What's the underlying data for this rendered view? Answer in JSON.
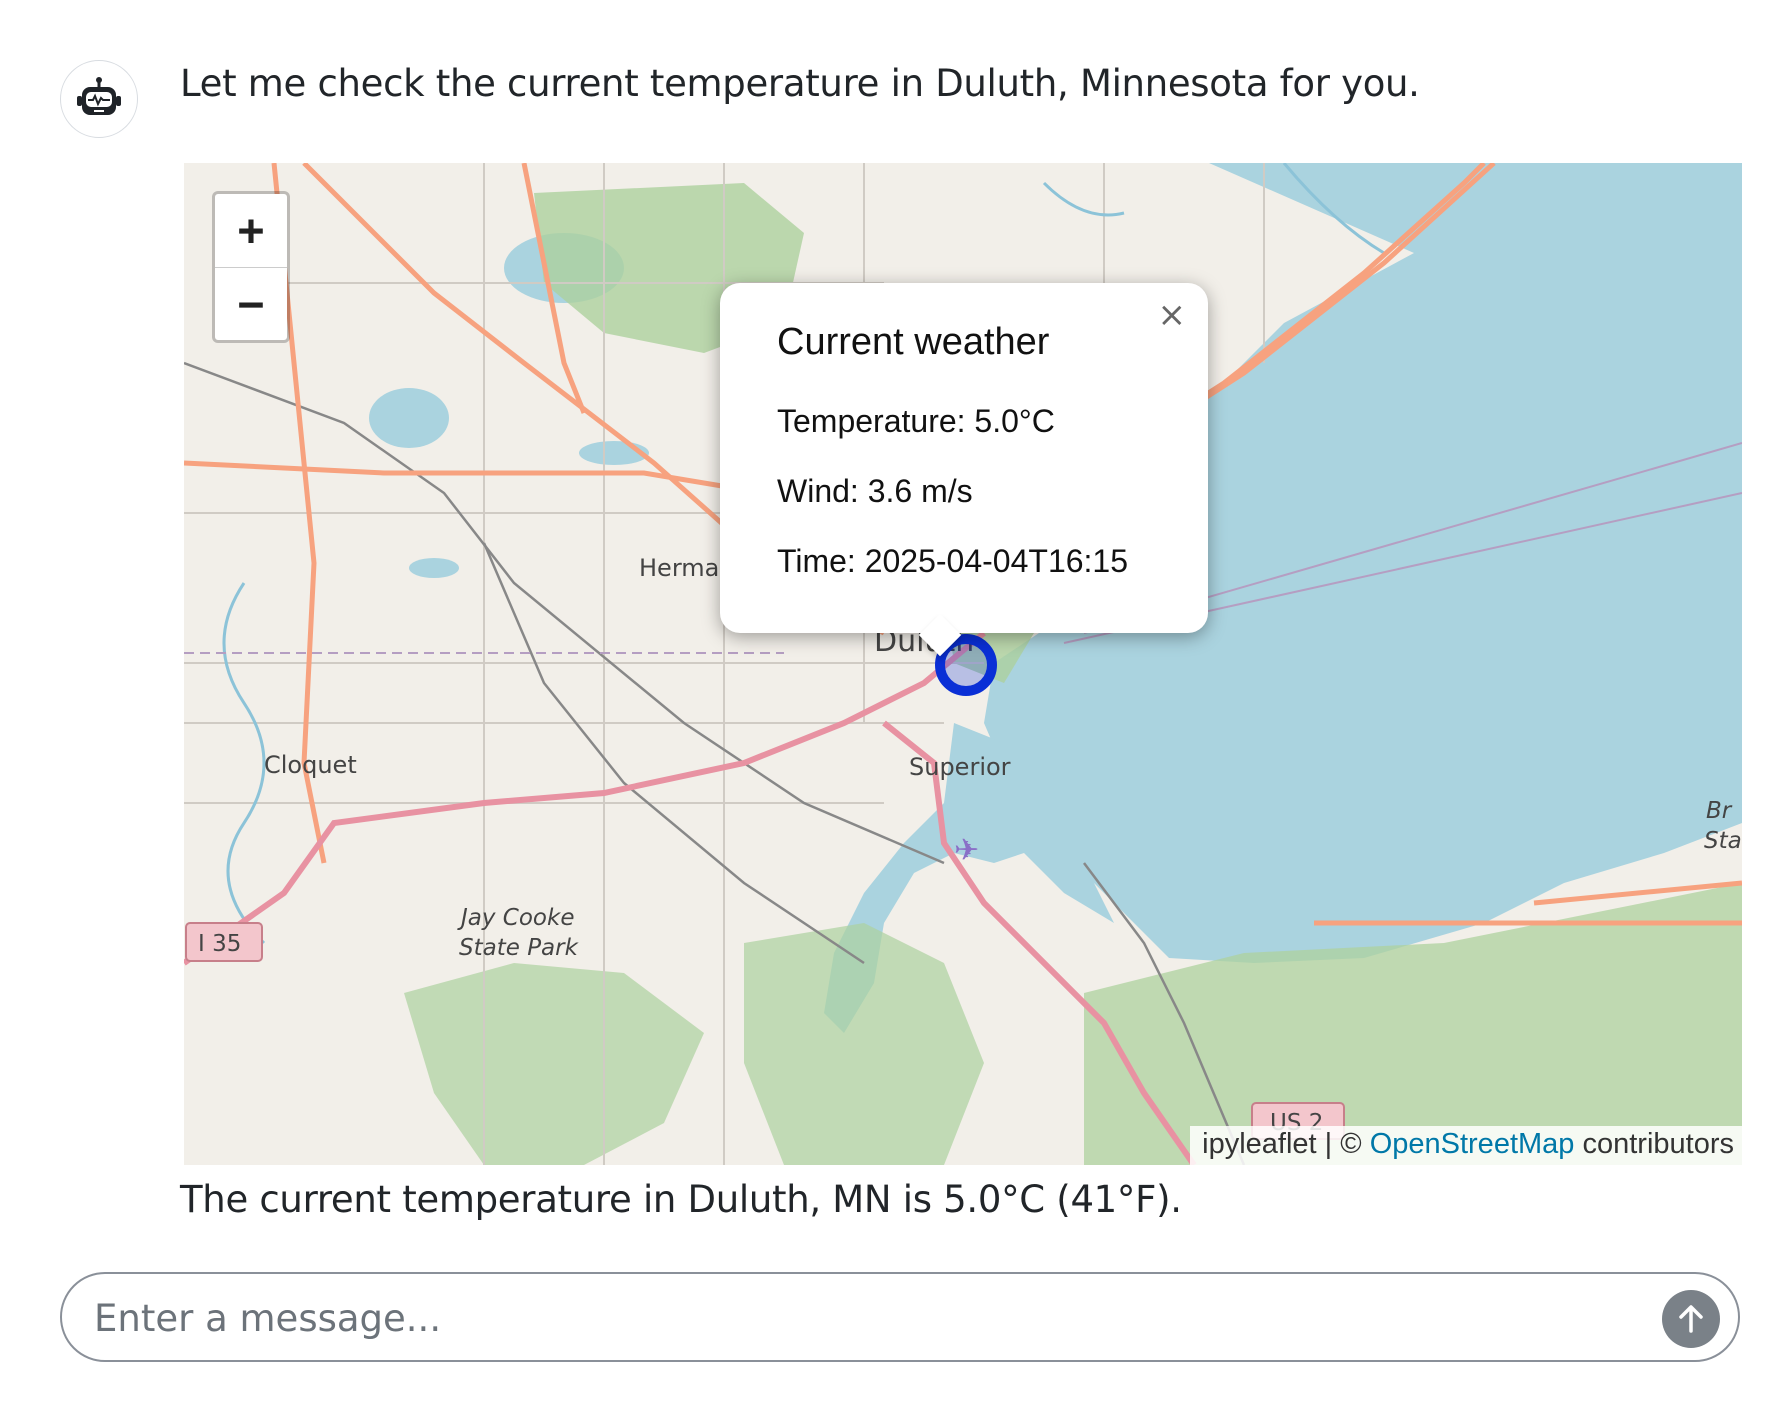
{
  "assistant": {
    "intro_message": "Let me check the current temperature in Duluth, Minnesota for you.",
    "result_message": "The current temperature in Duluth, MN is 5.0°C (41°F)."
  },
  "map": {
    "zoom_in_label": "+",
    "zoom_out_label": "−",
    "place_labels": {
      "duluth": "Duluth",
      "superior": "Superior",
      "cloquet": "Cloquet",
      "hermantown": "Herma",
      "jay_cooke_1": "Jay Cooke",
      "jay_cooke_2": "State Park",
      "brule_1": "Br",
      "brule_2": "Sta",
      "highway_i35": "I 35",
      "highway_us2": "US 2"
    },
    "popup": {
      "close_label": "×",
      "title": "Current weather",
      "temperature": "Temperature: 5.0°C",
      "wind": "Wind: 3.6 m/s",
      "time": "Time: 2025-04-04T16:15"
    },
    "attribution": {
      "prefix": "ipyleaflet | © ",
      "link": "OpenStreetMap",
      "suffix": " contributors"
    },
    "colors": {
      "land": "#f2efe9",
      "water": "#aad3df",
      "forest": "#add19e",
      "motorway": "#e892a2",
      "primary_road": "#f7a27f",
      "marker": "#0a2fd6"
    }
  },
  "composer": {
    "placeholder": "Enter a message..."
  }
}
